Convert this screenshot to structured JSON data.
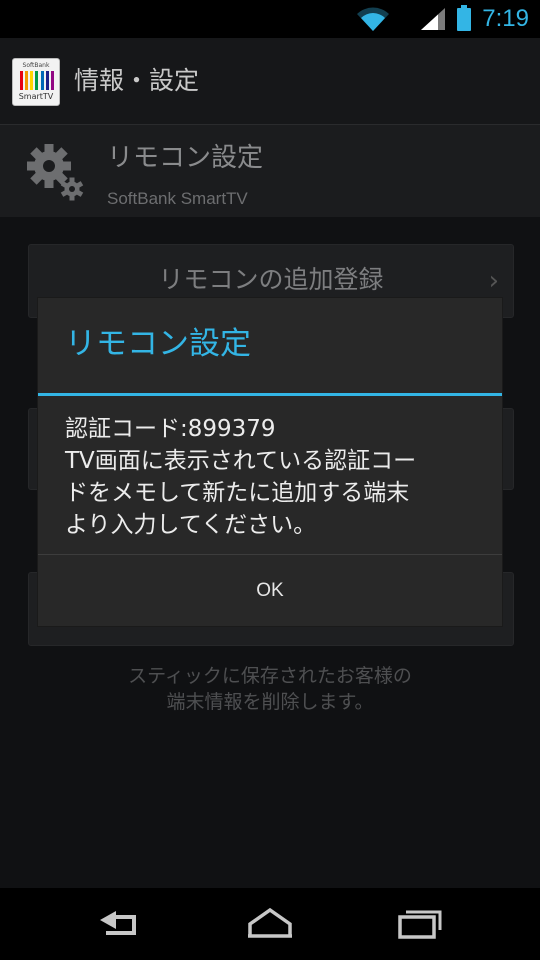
{
  "status_bar": {
    "time": "7:19",
    "wifi_icon": "wifi-icon",
    "signal_icon": "cell-signal-icon",
    "battery_icon": "battery-icon",
    "accent_color": "#33b5e5"
  },
  "action_bar": {
    "title": "情報・設定",
    "logo": {
      "top_text": "SoftBank",
      "bottom_text": "SmartTV",
      "bar_colors": [
        "#e60012",
        "#f39800",
        "#ffd400",
        "#009944",
        "#0068b7",
        "#1d2088",
        "#920783"
      ]
    }
  },
  "header": {
    "title": "リモコン設定",
    "subtitle": "SoftBank SmartTV",
    "icon": "gear-icon"
  },
  "background": {
    "menu_item_1": "リモコンの追加登録",
    "info_text_line1": "スティックに保存されたお客様の",
    "info_text_line2": "端末情報を削除します。"
  },
  "dialog": {
    "title": "リモコン設定",
    "message_lines": [
      "認証コード:899379",
      "TV画面に表示されている認証コー",
      "ドをメモして新たに追加する端末",
      "より入力してください。"
    ],
    "ok_label": "OK",
    "accent_color": "#33b5e5"
  },
  "nav_bar": {
    "back_icon": "back-icon",
    "home_icon": "home-icon",
    "recent_icon": "recent-apps-icon"
  }
}
